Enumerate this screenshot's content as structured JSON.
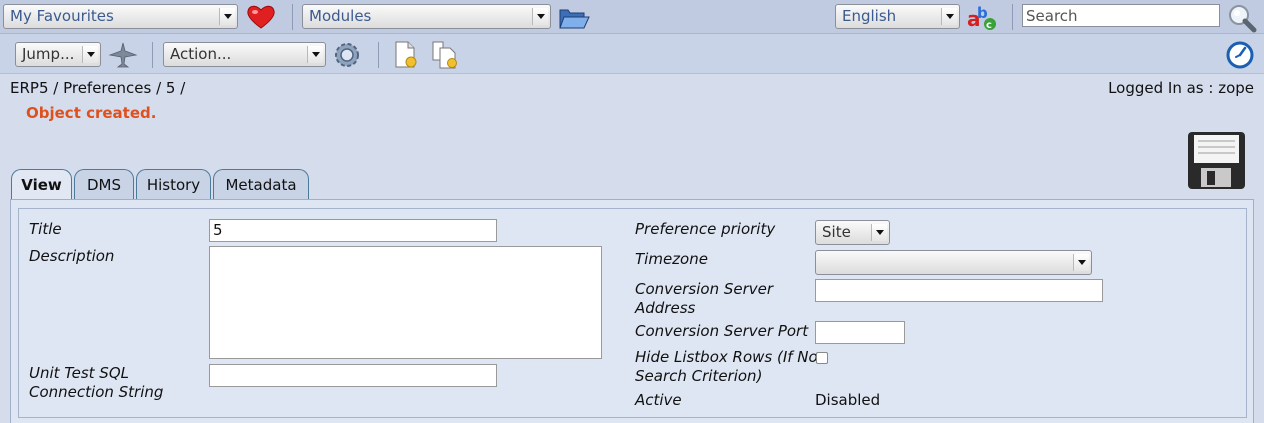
{
  "topbar": {
    "favourites_label": "My Favourites",
    "modules_label": "Modules",
    "language_label": "English",
    "search_placeholder": "Search"
  },
  "toolbar": {
    "jump_label": "Jump...",
    "action_label": "Action..."
  },
  "breadcrumb": "ERP5 / Preferences / 5 /",
  "logged_in": "Logged In as : zope",
  "status_message": "Object created.",
  "tabs": [
    {
      "label": "View",
      "active": true
    },
    {
      "label": "DMS"
    },
    {
      "label": "History"
    },
    {
      "label": "Metadata"
    }
  ],
  "form": {
    "title_label": "Title",
    "title_value": "5",
    "description_label": "Description",
    "description_value": "",
    "sql_label_1": "Unit Test SQL",
    "sql_label_2": "Connection String",
    "sql_value": "",
    "priority_label": "Preference priority",
    "priority_value": "Site",
    "timezone_label": "Timezone",
    "timezone_value": "",
    "conv_addr_label_1": "Conversion Server",
    "conv_addr_label_2": "Address",
    "conv_addr_value": "",
    "conv_port_label": "Conversion Server Port",
    "conv_port_value": "",
    "hide_rows_label_1": "Hide Listbox Rows (If No",
    "hide_rows_label_2": "Search Criterion)",
    "active_label": "Active",
    "active_value": "Disabled"
  },
  "colors": {
    "status": "#e0501c",
    "tab_border": "#4c7a99",
    "link_blue": "#3a5a90"
  }
}
